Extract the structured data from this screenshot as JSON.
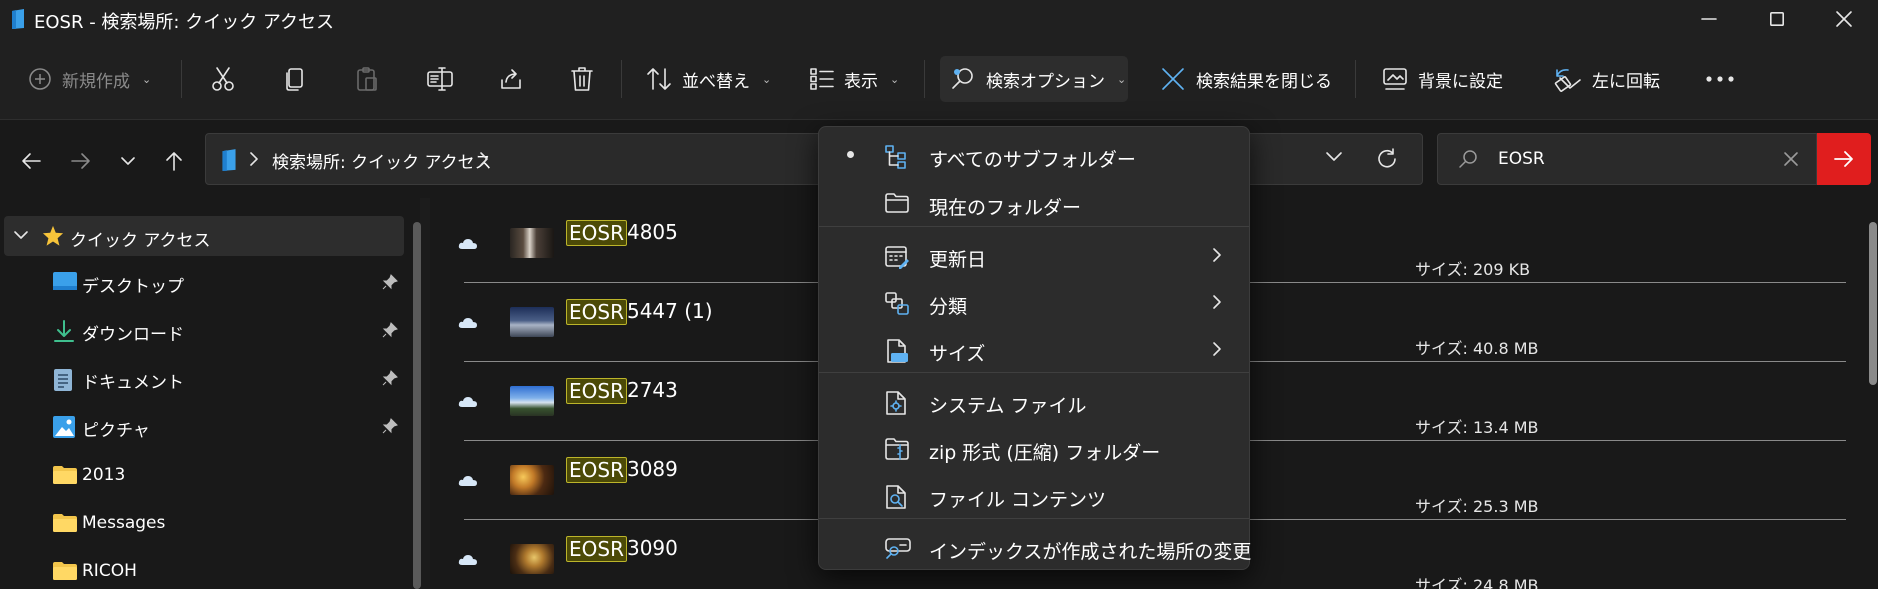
{
  "window": {
    "title": "EOSR - 検索場所: クイック アクセス"
  },
  "toolbar": {
    "new_label": "新規作成",
    "sort_label": "並べ替え",
    "view_label": "表示",
    "search_options_label": "検索オプション",
    "close_search_label": "検索結果を閉じる",
    "set_background_label": "背景に設定",
    "rotate_left_label": "左に回転"
  },
  "address": {
    "path": "検索場所: クイック アクセス"
  },
  "search": {
    "value": "EOSR"
  },
  "nav": {
    "quick_access": "クイック アクセス",
    "items": [
      {
        "label": "デスクトップ",
        "icon": "desktop-icon",
        "pinned": true
      },
      {
        "label": "ダウンロード",
        "icon": "download-icon",
        "pinned": true
      },
      {
        "label": "ドキュメント",
        "icon": "document-icon",
        "pinned": true
      },
      {
        "label": "ピクチャ",
        "icon": "pictures-icon",
        "pinned": true
      },
      {
        "label": "2013",
        "icon": "folder-icon",
        "pinned": false
      },
      {
        "label": "Messages",
        "icon": "folder-icon",
        "pinned": false
      },
      {
        "label": "RICOH",
        "icon": "folder-icon",
        "pinned": false
      }
    ]
  },
  "files": [
    {
      "match": "EOSR",
      "rest": "4805",
      "size": "サイズ: 209 KB"
    },
    {
      "match": "EOSR",
      "rest": "5447 (1)",
      "size": "サイズ: 40.8 MB"
    },
    {
      "match": "EOSR",
      "rest": "2743",
      "size": "サイズ: 13.4 MB"
    },
    {
      "match": "EOSR",
      "rest": "3089",
      "size": "サイズ: 25.3 MB"
    },
    {
      "match": "EOSR",
      "rest": "3090",
      "size": "サイズ: 24.8 MB"
    }
  ],
  "menu": {
    "items": [
      {
        "label": "すべてのサブフォルダー",
        "icon": "subfolders-icon",
        "checked": true,
        "submenu": false
      },
      {
        "label": "現在のフォルダー",
        "icon": "folder-outline-icon",
        "checked": false,
        "submenu": false
      },
      {
        "label": "更新日",
        "icon": "calendar-icon",
        "checked": false,
        "submenu": true
      },
      {
        "label": "分類",
        "icon": "kind-icon",
        "checked": false,
        "submenu": true
      },
      {
        "label": "サイズ",
        "icon": "size-icon",
        "checked": false,
        "submenu": true
      },
      {
        "label": "システム ファイル",
        "icon": "system-file-icon",
        "checked": false,
        "submenu": false
      },
      {
        "label": "zip 形式 (圧縮) フォルダー",
        "icon": "zip-folder-icon",
        "checked": false,
        "submenu": false
      },
      {
        "label": "ファイル コンテンツ",
        "icon": "file-contents-icon",
        "checked": false,
        "submenu": false
      },
      {
        "label": "インデックスが作成された場所の変更",
        "icon": "index-icon",
        "checked": false,
        "submenu": false
      }
    ]
  },
  "colors": {
    "background": "#191919",
    "menu_bg": "#2c2c2c",
    "accent_blue": "#5fb2f2",
    "search_go": "#e01e1e",
    "highlight_bg": "#4c4a07",
    "highlight_border": "#bcb52a",
    "folder_yellow": "#f2c54b"
  }
}
